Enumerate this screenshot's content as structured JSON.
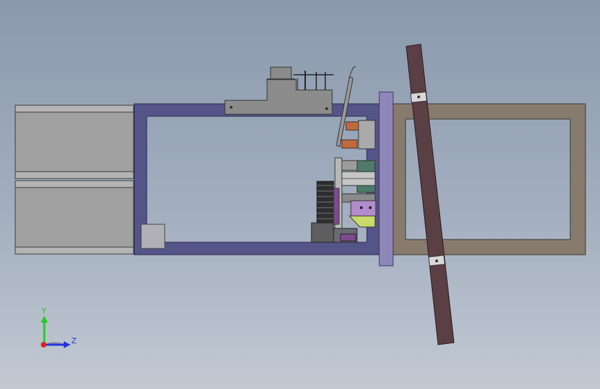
{
  "viewport": {
    "background_top": "#8a99ad",
    "background_bottom": "#c2c9d3"
  },
  "model": {
    "frame_color": "#545489",
    "plate_color": "#877b6e",
    "arm_color": "#5a3f44",
    "bracket_color": "#8f86b9",
    "housing_color": "#a0a0a0"
  },
  "triad": {
    "y_label": "Y",
    "z_label": "Z",
    "y_color": "#22cc22",
    "z_color": "#2233dd",
    "x_color": "#dd2222"
  }
}
